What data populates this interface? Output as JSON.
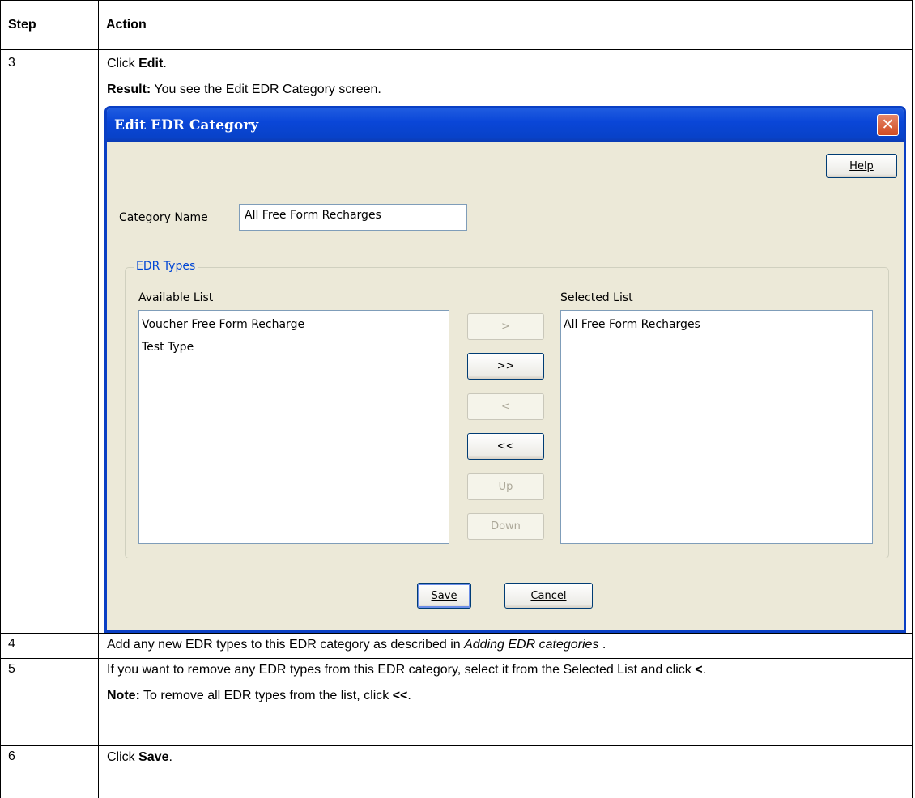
{
  "table": {
    "header_step": "Step",
    "header_action": "Action"
  },
  "rows": {
    "r3": {
      "step": "3",
      "line1_pre": "Click ",
      "line1_bold": "Edit",
      "line1_post": ".",
      "line2_bold": "Result:",
      "line2_text": " You see the Edit EDR Category screen."
    },
    "r4": {
      "step": "4",
      "text_pre": "Add any new EDR types to this EDR category as described in ",
      "text_italic": "Adding EDR categories",
      "text_post": " ."
    },
    "r5": {
      "step": "5",
      "line1_pre": "If you want to remove any EDR types from this EDR category, select it from the Selected List and click ",
      "line1_bold": "<",
      "line1_post": ".",
      "line2_bold": "Note:",
      "line2_pre": " To remove all EDR types from the list, click ",
      "line2_bold2": "<<",
      "line2_post": "."
    },
    "r6": {
      "step": "6",
      "line1_pre": "Click ",
      "line1_bold": "Save",
      "line1_post": "."
    }
  },
  "dialog": {
    "title": "Edit EDR Category",
    "close_glyph": "✕",
    "help_label": "Help",
    "category_name_label": "Category Name",
    "category_name_value": "All Free Form Recharges",
    "group_title": "EDR Types",
    "available_label": "Available List",
    "selected_label": "Selected List",
    "available_items": [
      "Voucher Free Form Recharge",
      "Test Type"
    ],
    "selected_items": [
      "All Free Form Recharges"
    ],
    "move_one_right": ">",
    "move_all_right": ">>",
    "move_one_left": "<",
    "move_all_left": "<<",
    "up_label": "Up",
    "down_label": "Down",
    "save_label": "Save",
    "cancel_label": "Cancel",
    "colors": {
      "titlebar": "#0A46D8",
      "frame": "#0A3FC4",
      "body": "#ECE9D8",
      "group_title": "#0046D5",
      "close": "#D24B21"
    }
  }
}
